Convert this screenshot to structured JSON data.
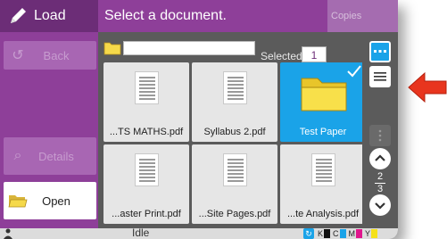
{
  "app": {
    "title": "Load",
    "header": "Select a document.",
    "copies_label": "Copies"
  },
  "sidebar": {
    "back_label": "Back",
    "details_label": "Details",
    "open_label": "Open"
  },
  "pathbar": {
    "path_value": "",
    "selected_label": "Selected",
    "selected_count": "1"
  },
  "files": [
    {
      "name": "...TS MATHS.pdf",
      "type": "pdf",
      "selected": false
    },
    {
      "name": "Syllabus 2.pdf",
      "type": "pdf",
      "selected": false
    },
    {
      "name": "Test Paper",
      "type": "folder",
      "selected": true
    },
    {
      "name": "...aster Print.pdf",
      "type": "pdf",
      "selected": false
    },
    {
      "name": "...Site Pages.pdf",
      "type": "pdf",
      "selected": false
    },
    {
      "name": "...te Analysis.pdf",
      "type": "pdf",
      "selected": false
    }
  ],
  "pager": {
    "current": "2",
    "total": "3"
  },
  "status": {
    "text": "Idle",
    "toner": [
      {
        "label": "K",
        "color": "#111111"
      },
      {
        "label": "C",
        "color": "#1aa3e8"
      },
      {
        "label": "M",
        "color": "#e0168d"
      },
      {
        "label": "Y",
        "color": "#f5e11a"
      }
    ]
  },
  "colors": {
    "accent": "#8e3f99",
    "accent_dark": "#6c2d77",
    "selection": "#1aa3e8",
    "callout_arrow": "#e8351e"
  }
}
